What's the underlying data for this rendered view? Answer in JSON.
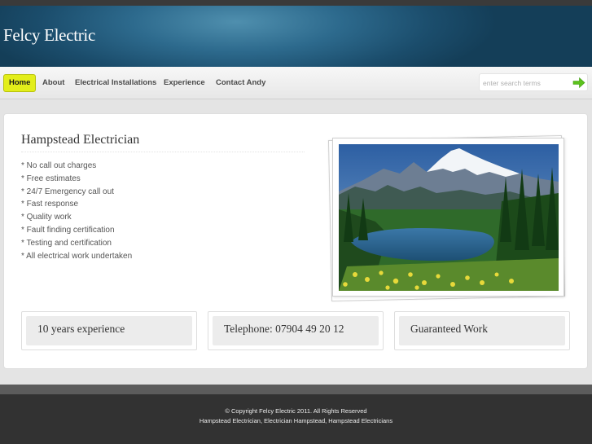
{
  "header": {
    "site_title": "Felcy Electric"
  },
  "nav": {
    "items": [
      {
        "label": "Home",
        "active": true
      },
      {
        "label": "About"
      },
      {
        "label": "Electrical Installations"
      },
      {
        "label": "Experience"
      },
      {
        "label": "Contact Andy"
      }
    ]
  },
  "search": {
    "placeholder": "enter search terms",
    "button_icon": "arrow-right-icon"
  },
  "main": {
    "title": "Hampstead Electrician",
    "features": [
      "* No call out charges",
      "* Free estimates",
      "* 24/7 Emergency call out",
      "* Fast response",
      "* Quality work",
      "* Fault finding certification",
      "* Testing and certification",
      "* All electrical work undertaken"
    ],
    "image_subject": "mountain-lake-landscape"
  },
  "info_boxes": [
    {
      "text": "10 years experience"
    },
    {
      "text": "Telephone: 07904 49 20 12"
    },
    {
      "text": "Guaranteed Work"
    }
  ],
  "footer": {
    "copyright": "© Copyright Felcy Electric 2011. All Rights Reserved",
    "keywords": "Hampstead Electrician, Electrician Hampstead, Hampstead Electricians"
  },
  "colors": {
    "header_blue": "#1b4d6c",
    "active_nav": "#e3ee1a",
    "search_arrow": "#5cc21c",
    "footer_bg": "#323232"
  }
}
